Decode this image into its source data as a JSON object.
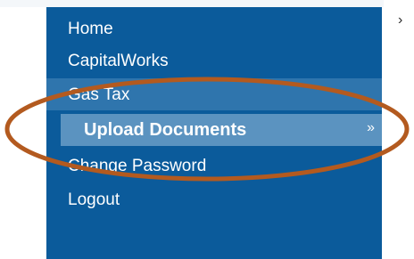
{
  "menu": {
    "items": [
      {
        "label": "Home"
      },
      {
        "label": "CapitalWorks"
      },
      {
        "label": "Gas Tax"
      },
      {
        "label": "Upload Documents"
      },
      {
        "label": "Change Password"
      },
      {
        "label": "Logout"
      }
    ]
  },
  "icons": {
    "submenu_chevron": "double-chevron-right-icon",
    "outside_chevron": "chevron-right-icon"
  },
  "colors": {
    "sidebar_bg": "#0b5b9b",
    "parent_highlight": "#2f75ad",
    "sub_highlight": "#5b93c0",
    "annotation_oval": "#b35a1f"
  }
}
